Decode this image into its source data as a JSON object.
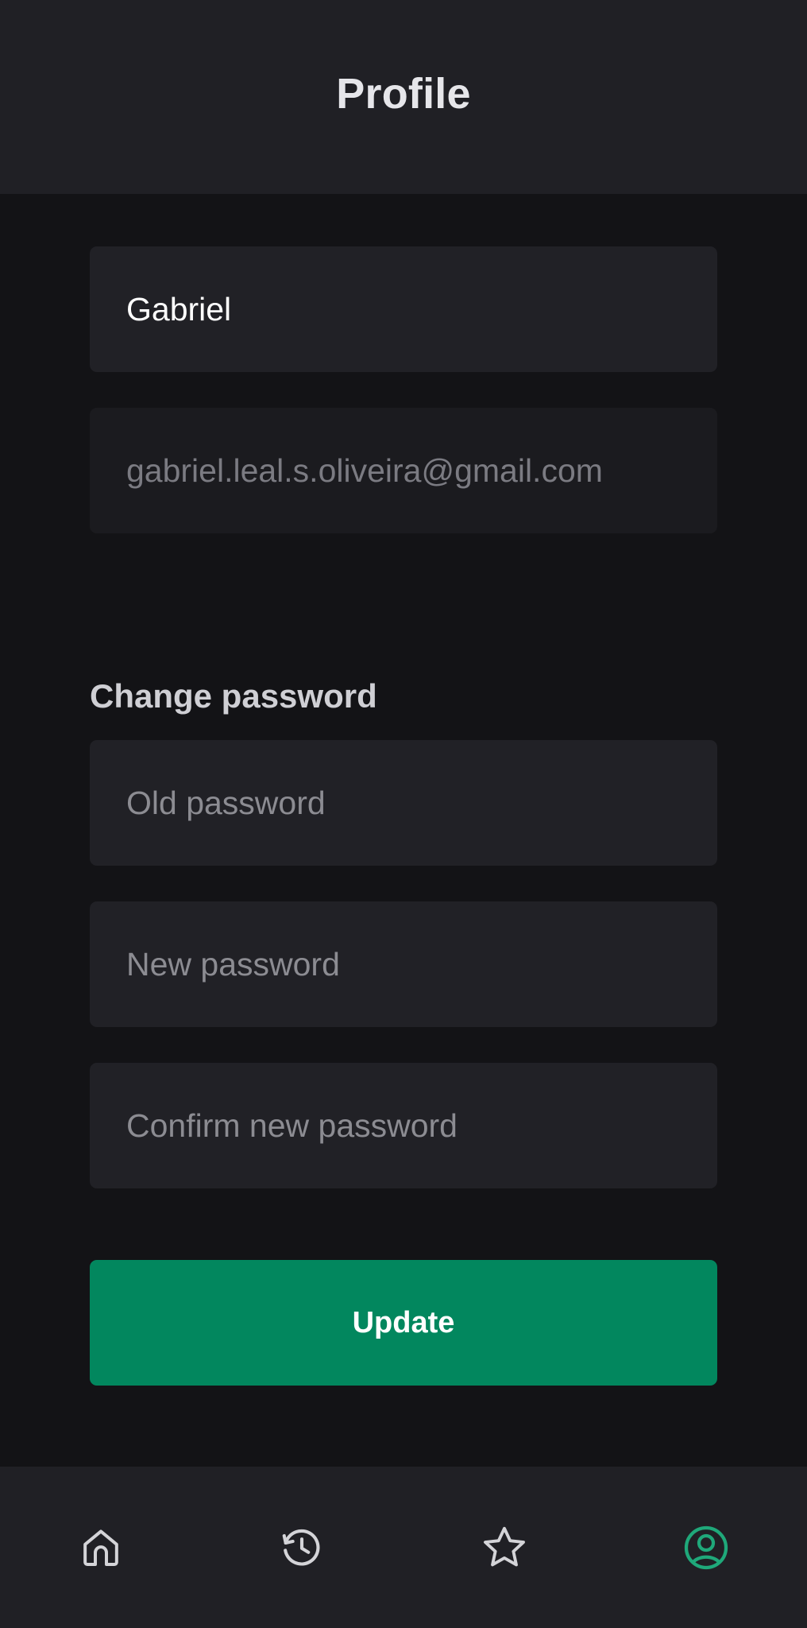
{
  "header": {
    "title": "Profile"
  },
  "profile": {
    "name_value": "Gabriel",
    "email_value": "gabriel.leal.s.oliveira@gmail.com"
  },
  "password": {
    "section_title": "Change password",
    "old_placeholder": "Old password",
    "new_placeholder": "New password",
    "confirm_placeholder": "Confirm new password"
  },
  "actions": {
    "update_label": "Update"
  },
  "bottom_nav": {
    "items": [
      {
        "icon": "home-icon",
        "active": false
      },
      {
        "icon": "history-icon",
        "active": false
      },
      {
        "icon": "star-icon",
        "active": false
      },
      {
        "icon": "user-circle-icon",
        "active": true
      }
    ],
    "active_color": "#1fa87a",
    "inactive_color": "#d4d4d8"
  },
  "colors": {
    "background": "#131316",
    "surface": "#212126",
    "accent": "#02875e"
  }
}
